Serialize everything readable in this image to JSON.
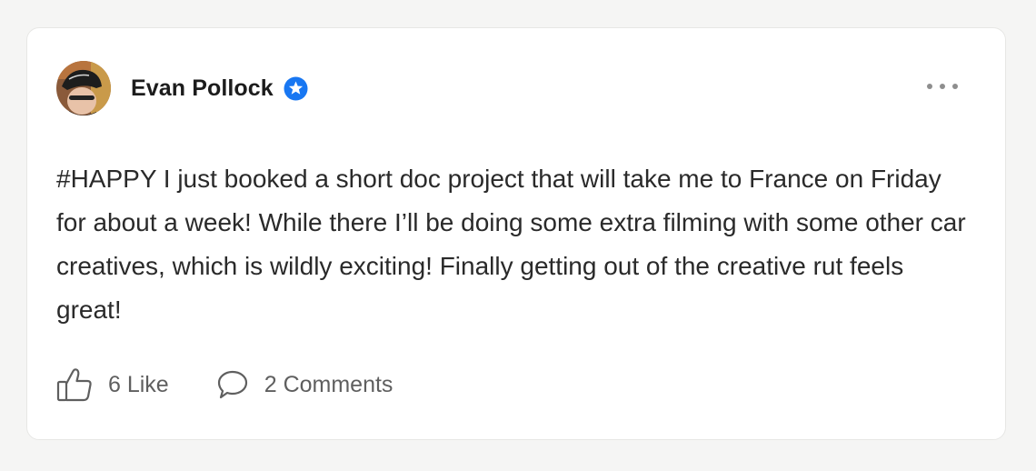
{
  "post": {
    "author": {
      "name": "Evan Pollock",
      "verified": true
    },
    "text": "#HAPPY I just booked a short doc project that will take me to France on Friday for about a week! While there I’ll be doing some extra filming with some other car creatives, which is wildly exciting! Finally getting out of the creative rut feels great!",
    "actions": {
      "like_label": "6 Like",
      "comment_label": "2 Comments"
    }
  },
  "icons": {
    "verified": "verified-badge-icon",
    "more": "more-dots-icon",
    "like": "thumbs-up-icon",
    "comment": "comment-bubble-icon"
  },
  "colors": {
    "accent": "#1877f2",
    "background": "#f5f5f4",
    "card": "#ffffff",
    "text": "#2a2a2a",
    "muted": "#5f5f5f"
  }
}
